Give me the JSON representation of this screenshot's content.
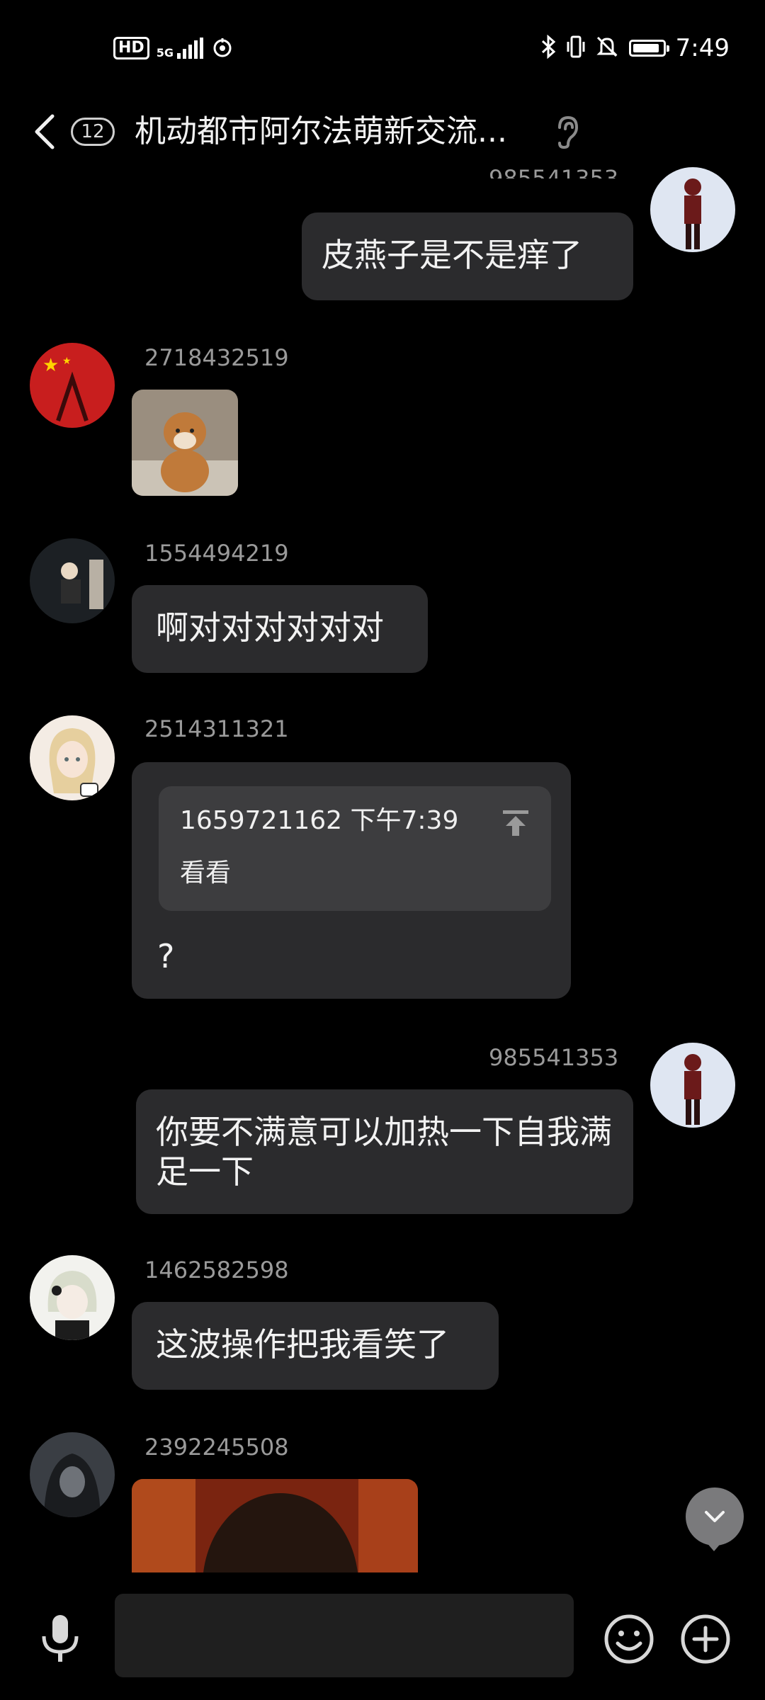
{
  "status_bar": {
    "hd_label": "HD",
    "network_label": "5G",
    "time": "7:49",
    "battery_level": 0.9
  },
  "header": {
    "unread_count": "12",
    "title": "机动都市阿尔法萌新交流..."
  },
  "messages": [
    {
      "sender": "985541353",
      "side": "right",
      "text": "皮燕子是不是痒了"
    },
    {
      "sender": "2718432519",
      "side": "left",
      "type": "image"
    },
    {
      "sender": "1554494219",
      "side": "left",
      "text": "啊对对对对对对"
    },
    {
      "sender": "2514311321",
      "side": "left",
      "quote": {
        "author": "1659721162",
        "time": "下午7:39",
        "text": "看看"
      },
      "text": "?"
    },
    {
      "sender": "985541353",
      "side": "right",
      "text": "你要不满意可以加热一下自我满足一下"
    },
    {
      "sender": "1462582598",
      "side": "left",
      "text": "这波操作把我看笑了"
    },
    {
      "sender": "2392245508",
      "side": "left",
      "type": "image"
    }
  ],
  "icons": {
    "back": "chevron-left-icon",
    "ear": "ear-icon",
    "scroll_down": "chevron-down-icon",
    "voice": "microphone-icon",
    "emoji": "smiley-icon",
    "more": "plus-circle-icon"
  }
}
